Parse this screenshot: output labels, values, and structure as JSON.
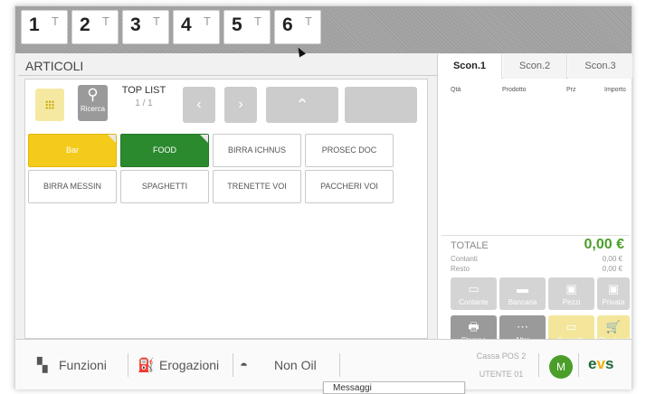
{
  "tabs": [
    {
      "num": "1",
      "tag": "T"
    },
    {
      "num": "2",
      "tag": "T"
    },
    {
      "num": "3",
      "tag": "T"
    },
    {
      "num": "4",
      "tag": "T"
    },
    {
      "num": "5",
      "tag": "T"
    },
    {
      "num": "6",
      "tag": "T"
    }
  ],
  "left": {
    "title": "ARTICOLI",
    "search_label": "Ricerca",
    "toplist_title": "TOP LIST",
    "toplist_page": "1 / 1",
    "prev_icon": "‹",
    "next_icon": "›",
    "up_icon": "⌃"
  },
  "articles": [
    {
      "label": "Bar",
      "style": "yellow"
    },
    {
      "label": "FOOD",
      "style": "green"
    },
    {
      "label": "BIRRA ICHNUS",
      "style": "white"
    },
    {
      "label": "PROSEC DOC",
      "style": "white"
    },
    {
      "label": "BIRRA MESSIN",
      "style": "white"
    },
    {
      "label": "SPAGHETTI",
      "style": "white"
    },
    {
      "label": "TRENETTE VOI",
      "style": "white"
    },
    {
      "label": "PACCHERI VOI",
      "style": "white"
    }
  ],
  "receipt": {
    "tabs": [
      "Scon.1",
      "Scon.2",
      "Scon.3"
    ],
    "columns": [
      "Qtà",
      "Prodotto",
      "Prz",
      "Importo"
    ],
    "totale_label": "TOTALE",
    "totale_value": "0,00 €",
    "contanti_label": "Contanti",
    "contanti_value": "0,00 €",
    "resto_label": "Resto",
    "resto_value": "0,00 €",
    "pay_row1": [
      "Contante",
      "Bancaria",
      "Pezzi",
      "Privata"
    ],
    "pay_row2": [
      "Stampa",
      "Altro",
      "Cassetto",
      "Checkout"
    ]
  },
  "bottom": {
    "funzioni": "Funzioni",
    "erogazioni": "Erogazioni",
    "non_oil": "Non Oil",
    "messaggi": "Messaggi",
    "cassa": "Cassa POS 2",
    "utente": "UTENTE 01",
    "avatar": "M",
    "logo_1": "e",
    "logo_2": "v",
    "logo_3": "s"
  },
  "colors": {
    "accent_green": "#4a9e29",
    "bar_yellow": "#f4cb1b",
    "food_green": "#2b8a2e"
  }
}
